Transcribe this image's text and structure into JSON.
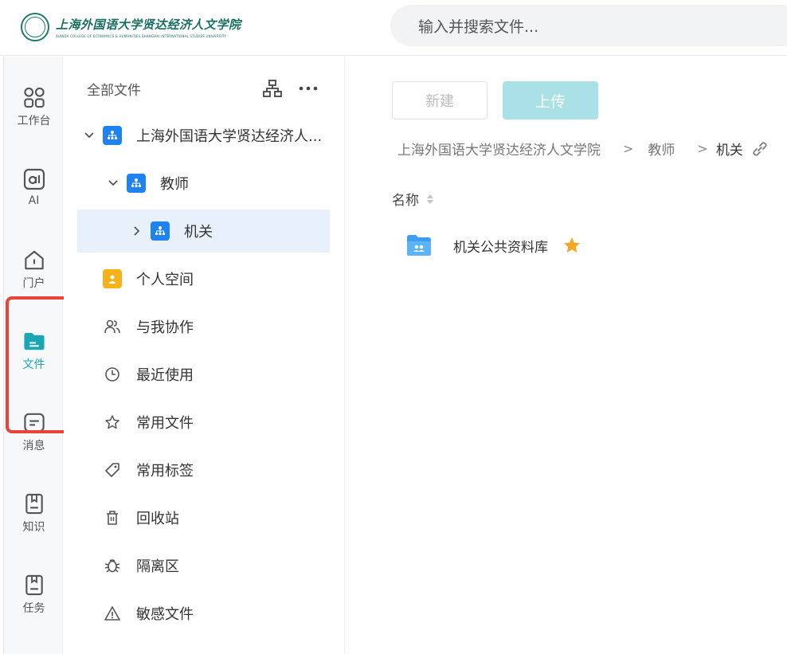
{
  "header": {
    "logo_cn": "上海外国语大学贤达经济人文学院",
    "logo_en": "XIANDA COLLEGE OF ECONOMICS & HUMANITIES SHANGHAI INTERNATIONAL STUDIES UNIVERSITY",
    "search_placeholder": "输入并搜索文件..."
  },
  "rail": {
    "items": [
      {
        "label": "工作台",
        "icon": "grid-icon"
      },
      {
        "label": "AI",
        "icon": "ai-icon"
      },
      {
        "label": "门户",
        "icon": "home-icon"
      },
      {
        "label": "文件",
        "icon": "folder-icon",
        "active": true
      },
      {
        "label": "消息",
        "icon": "message-icon"
      },
      {
        "label": "知识",
        "icon": "book-icon"
      },
      {
        "label": "任务",
        "icon": "task-icon"
      }
    ],
    "active_color": "#1aa7b3"
  },
  "tree": {
    "title": "全部文件",
    "items": [
      {
        "label": "上海外国语大学贤达经济人...",
        "icon": "org-icon",
        "expanded": true
      },
      {
        "label": "教师",
        "icon": "org-icon",
        "expanded": true
      },
      {
        "label": "机关",
        "icon": "org-icon",
        "selected": true
      },
      {
        "label": "个人空间",
        "icon": "person-icon"
      },
      {
        "label": "与我协作",
        "icon": "users-icon"
      },
      {
        "label": "最近使用",
        "icon": "clock-icon"
      },
      {
        "label": "常用文件",
        "icon": "star-outline-icon"
      },
      {
        "label": "常用标签",
        "icon": "tag-icon"
      },
      {
        "label": "回收站",
        "icon": "trash-icon"
      },
      {
        "label": "隔离区",
        "icon": "bug-icon"
      },
      {
        "label": "敏感文件",
        "icon": "warning-icon"
      }
    ]
  },
  "main": {
    "new_label": "新建",
    "upload_label": "上传",
    "breadcrumb": [
      "上海外国语大学贤达经济人文学院",
      "教师",
      "机关"
    ],
    "column_name": "名称",
    "files": [
      {
        "name": "机关公共资料库",
        "icon": "shared-folder-icon",
        "starred": true
      }
    ]
  },
  "colors": {
    "accent": "#1aa7b3",
    "upload_button": "#a9e1e7",
    "org_badge": "#1e82f0",
    "person_badge": "#f5b21a",
    "star": "#f5a623",
    "annotation_red": "#e8443a"
  }
}
